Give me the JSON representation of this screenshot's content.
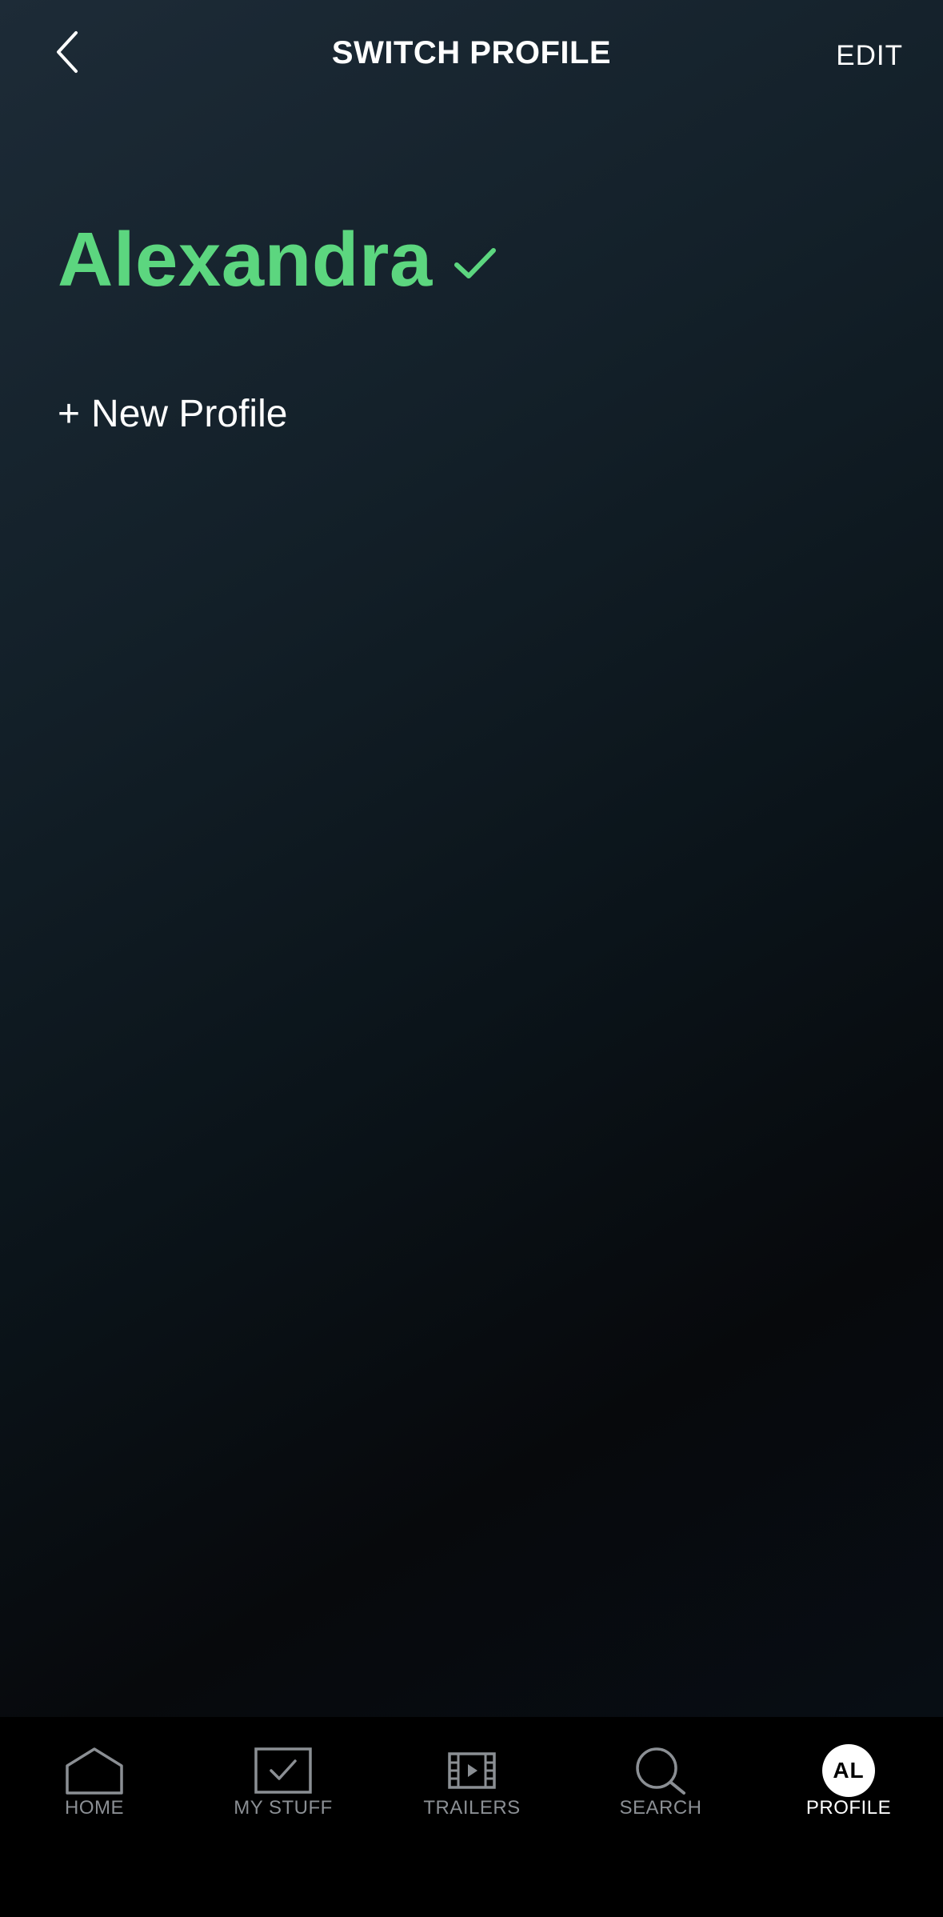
{
  "header": {
    "title": "SWITCH PROFILE",
    "back_icon": "chevron-left-icon",
    "edit_label": "EDIT"
  },
  "profiles": {
    "current": {
      "name": "Alexandra",
      "selected_icon": "checkmark-icon"
    },
    "new_profile_plus": "+",
    "new_profile_label": "New Profile"
  },
  "nav": {
    "items": [
      {
        "label": "HOME",
        "icon": "home-icon"
      },
      {
        "label": "MY STUFF",
        "icon": "my-stuff-icon"
      },
      {
        "label": "TRAILERS",
        "icon": "film-icon"
      },
      {
        "label": "SEARCH",
        "icon": "search-icon"
      },
      {
        "label": "PROFILE",
        "icon": "avatar",
        "avatar_initials": "AL",
        "active": true
      }
    ]
  },
  "colors": {
    "accent_green": "#5cd67f",
    "nav_inactive": "#8b8f94",
    "nav_background": "#000000"
  }
}
